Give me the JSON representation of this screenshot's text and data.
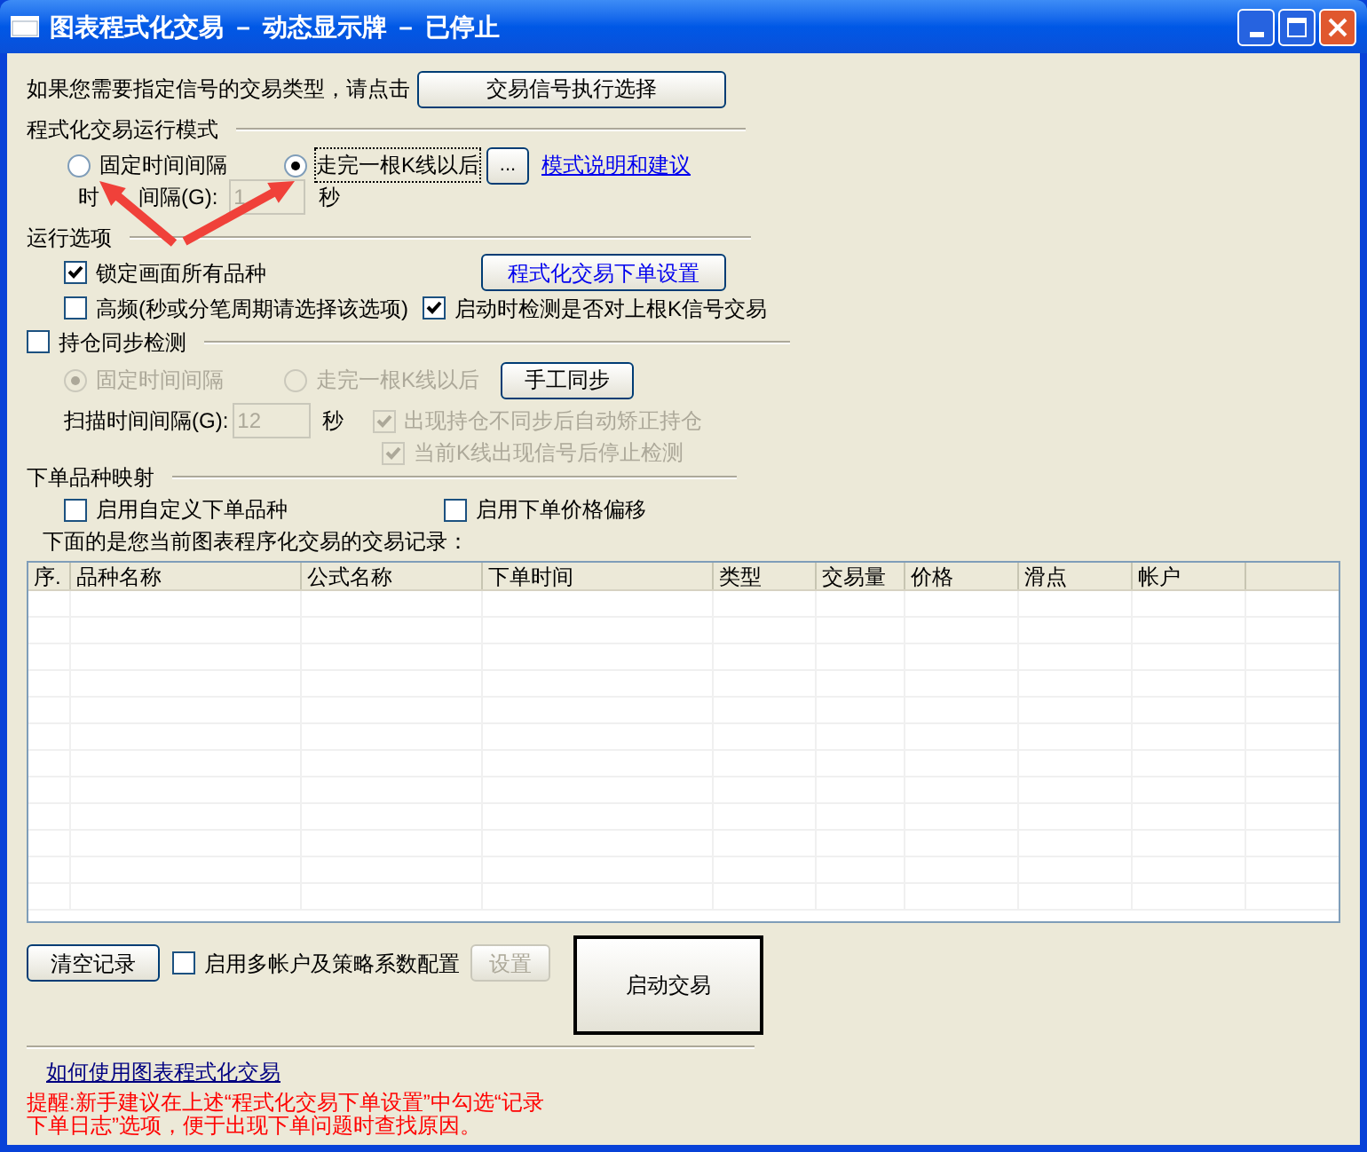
{
  "window": {
    "title": "图表程式化交易 － 动态显示牌 － 已停止"
  },
  "signal_prompt": {
    "text": "如果您需要指定信号的交易类型，请点击",
    "button": "交易信号执行选择"
  },
  "run_mode": {
    "title": "程式化交易运行模式",
    "options": [
      {
        "label": "固定时间间隔",
        "selected": false
      },
      {
        "label": "走完一根K线以后",
        "selected": true
      }
    ],
    "more_button": "...",
    "help_link": "模式说明和建议",
    "interval_label_start": "时",
    "interval_label_end": "间隔(G):",
    "interval_value": "1",
    "unit": "秒"
  },
  "run_options": {
    "title": "运行选项",
    "checkboxes": [
      {
        "label": "锁定画面所有品种",
        "checked": true
      },
      {
        "label": "高频(秒或分笔周期请选择该选项)",
        "checked": false
      },
      {
        "label": "启动时检测是否对上根K信号交易",
        "checked": true
      }
    ],
    "order_settings_button": "程式化交易下单设置"
  },
  "position_sync": {
    "title": "持仓同步检测",
    "checked": false,
    "disabled": true,
    "options": [
      {
        "label": "固定时间间隔",
        "selected": true
      },
      {
        "label": "走完一根K线以后",
        "selected": false
      }
    ],
    "manual_button": "手工同步",
    "scan_label": "扫描时间间隔(G):",
    "scan_value": "12",
    "unit": "秒",
    "checkboxes": [
      {
        "label": "出现持仓不同步后自动矫正持仓",
        "checked": true
      },
      {
        "label": "当前K线出现信号后停止检测",
        "checked": true
      }
    ]
  },
  "mapping": {
    "title": "下单品种映射",
    "checkboxes": [
      {
        "label": "启用自定义下单品种",
        "checked": false
      },
      {
        "label": "启用下单价格偏移",
        "checked": false
      }
    ]
  },
  "records_caption": "下面的是您当前图表程序化交易的交易记录：",
  "table": {
    "columns": [
      "序.",
      "品种名称",
      "公式名称",
      "下单时间",
      "类型",
      "交易量",
      "价格",
      "滑点",
      "帐户"
    ]
  },
  "bottom": {
    "clear_button": "清空记录",
    "multi_account": {
      "label": "启用多帐户及策略系数配置",
      "checked": false
    },
    "settings_button": {
      "label": "设置",
      "disabled": true
    },
    "start_button": "启动交易"
  },
  "help_link": "如何使用图表程式化交易",
  "notice_lines": [
    "提醒:新手建议在上述“程式化交易下单设置”中勾选“记录",
    "下单日志”选项，便于出现下单问题时查找原因。"
  ]
}
